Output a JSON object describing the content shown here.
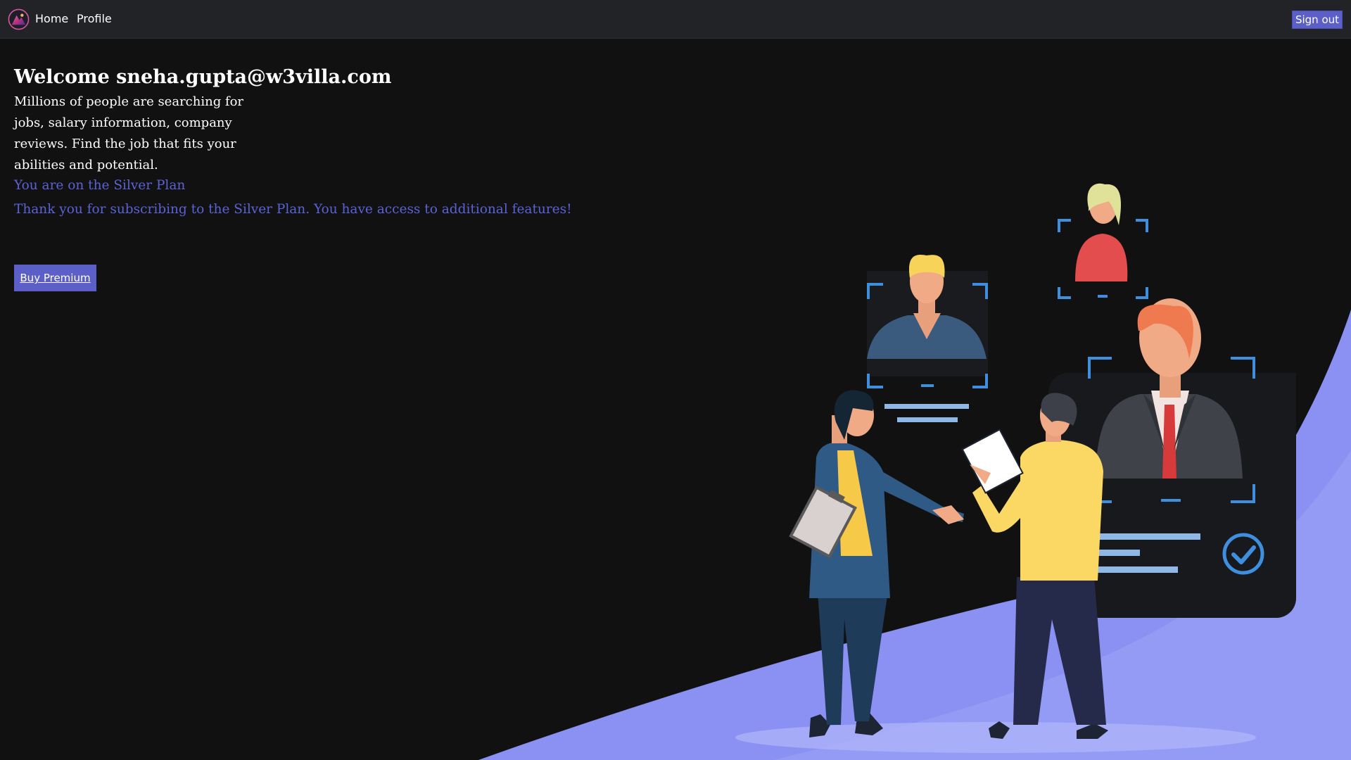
{
  "navbar": {
    "logo_icon": "app-logo-icon",
    "links": [
      {
        "label": "Home"
      },
      {
        "label": "Profile"
      }
    ],
    "sign_out_label": "Sign out"
  },
  "hero": {
    "welcome": "Welcome sneha.gupta@w3villa.com",
    "intro": "Millions of people are searching for jobs, salary information, company reviews. Find the job that fits your abilities and potential.",
    "plan_status": "You are on the Silver Plan",
    "thanks_message": "Thank you for subscribing to the Silver Plan. You have access to additional features!",
    "buy_premium_label": "Buy Premium"
  },
  "colors": {
    "navbar_bg": "#212327",
    "page_bg": "#111112",
    "accent": "#5b5fc7",
    "plan_text": "#5b62d6",
    "wave": "#8a91f2"
  }
}
